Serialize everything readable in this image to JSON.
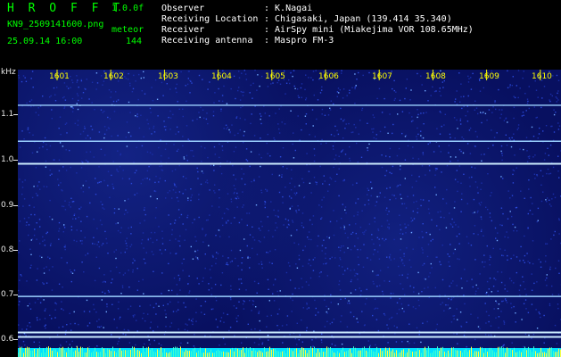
{
  "header": {
    "logo": "H R O F F T",
    "version": "1.0.0f",
    "filename": "KN9_2509141600.png",
    "mode": "meteor",
    "datetime": "25.09.14 16:00",
    "count": "144",
    "info_labels": [
      "Observer",
      "Receiving Location",
      "Receiver",
      "Receiving antenna"
    ],
    "info_values": [
      ": K.Nagai",
      ": Chigasaki, Japan (139.414 35.340)",
      ": AirSpy mini (Miakejima VOR 108.65MHz)",
      ": Maspro FM-3"
    ]
  },
  "colors": {
    "accent": "#00ff00",
    "label": "#ffffff",
    "axis_minutes": "#ffff00",
    "background": "#000000",
    "noise_floor": "#081060",
    "carrier": "#9ad0ff",
    "bottom_band": "#00e0ff"
  },
  "spectrogram": {
    "y_unit": "kHz",
    "y_ticks": [
      "1.1",
      "1.0",
      "0.9",
      "0.8",
      "0.7",
      "0.6"
    ],
    "y_range": [
      0.57,
      1.2
    ],
    "x_ticks": [
      "1601",
      "1602",
      "1603",
      "1604",
      "1605",
      "1606",
      "1607",
      "1608",
      "1609",
      "1610"
    ],
    "carriers_khz": [
      1.12,
      1.04,
      0.99,
      0.695,
      0.615,
      0.605
    ]
  }
}
